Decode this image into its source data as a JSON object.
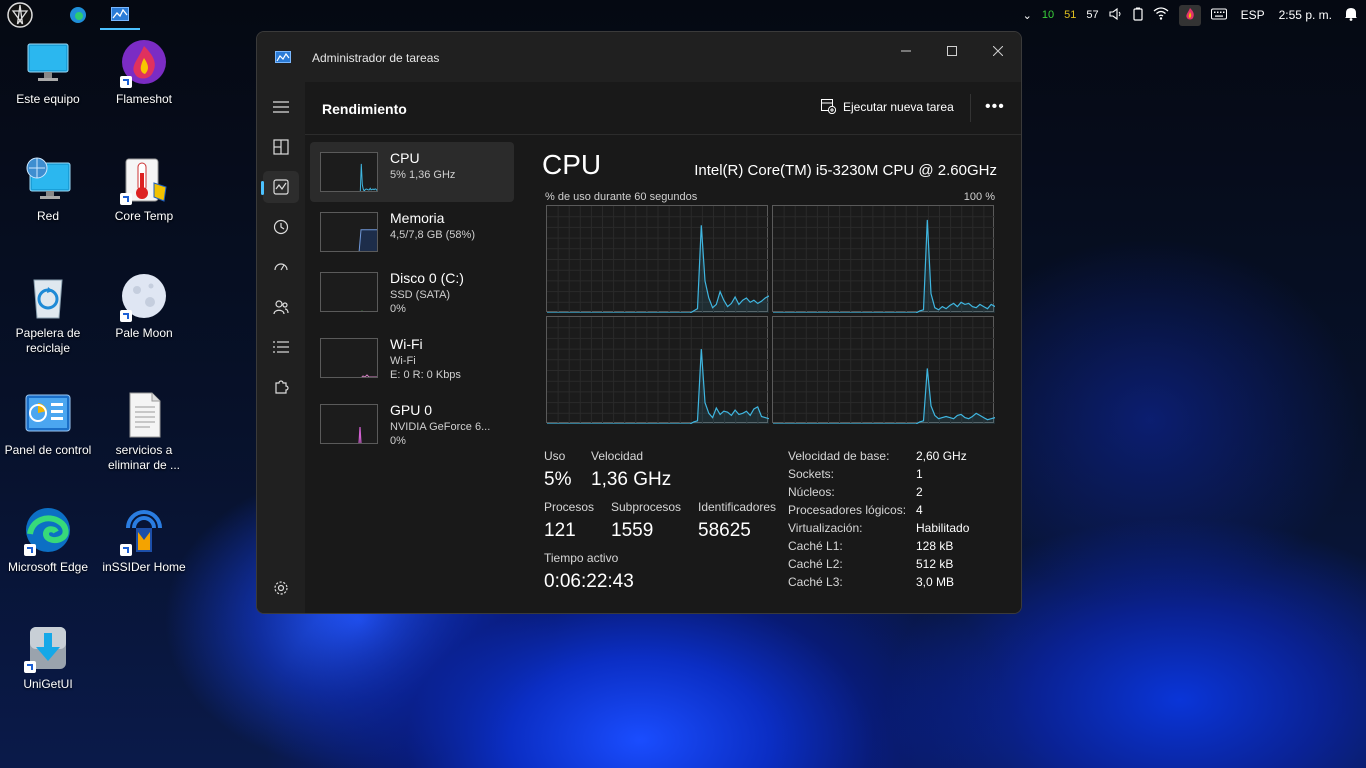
{
  "window": {
    "title": "Administrador de tareas",
    "header_title": "Rendimiento",
    "run_task_label": "Ejecutar nueva tarea",
    "more_label": "•••"
  },
  "desktop_icons": [
    {
      "label": "Este equipo",
      "icon": "computer-icon"
    },
    {
      "label": "Flameshot",
      "icon": "flameshot-icon"
    },
    {
      "label": "Red",
      "icon": "network-icon"
    },
    {
      "label": "Core Temp",
      "icon": "thermometer-icon"
    },
    {
      "label": "Papelera de reciclaje",
      "icon": "recycle-bin-icon"
    },
    {
      "label": "Pale Moon",
      "icon": "pale-moon-icon"
    },
    {
      "label": "Panel de control",
      "icon": "control-panel-icon"
    },
    {
      "label": "servicios a eliminar de ...",
      "icon": "document-icon"
    },
    {
      "label": "Microsoft Edge",
      "icon": "edge-icon"
    },
    {
      "label": "inSSIDer Home",
      "icon": "inssider-icon"
    },
    {
      "label": "UniGetUI",
      "icon": "unigetui-icon"
    }
  ],
  "tray": {
    "n1": "10",
    "n2": "51",
    "n3": "57",
    "n1_color": "#3ad13a",
    "n2_color": "#e0c020",
    "n3_color": "#ffffff",
    "language": "ESP",
    "time": "2:55 p. m."
  },
  "perf_items": [
    {
      "name": "CPU",
      "line1": "5%  1,36 GHz",
      "line2": ""
    },
    {
      "name": "Memoria",
      "line1": "4,5/7,8 GB (58%)",
      "line2": ""
    },
    {
      "name": "Disco 0 (C:)",
      "line1": "SSD (SATA)",
      "line2": "0%"
    },
    {
      "name": "Wi-Fi",
      "line1": "Wi-Fi",
      "line2": "E: 0 R: 0 Kbps"
    },
    {
      "name": "GPU 0",
      "line1": "NVIDIA GeForce 6...",
      "line2": "0%"
    }
  ],
  "cpu": {
    "title": "CPU",
    "model": "Intel(R) Core(TM) i5-3230M CPU @ 2.60GHz",
    "graph_caption": "% de uso durante 60 segundos",
    "graph_max": "100 %",
    "stats": {
      "uso_label": "Uso",
      "uso_value": "5%",
      "velocidad_label": "Velocidad",
      "velocidad_value": "1,36 GHz",
      "procesos_label": "Procesos",
      "procesos_value": "121",
      "subprocesos_label": "Subprocesos",
      "subprocesos_value": "1559",
      "identificadores_label": "Identificadores",
      "identificadores_value": "58625",
      "tiempo_label": "Tiempo activo",
      "tiempo_value": "0:06:22:43"
    },
    "specs": [
      {
        "key": "Velocidad de base:",
        "value": "2,60 GHz"
      },
      {
        "key": "Sockets:",
        "value": "1"
      },
      {
        "key": "Núcleos:",
        "value": "2"
      },
      {
        "key": "Procesadores lógicos:",
        "value": "4"
      },
      {
        "key": "Virtualización:",
        "value": "Habilitado"
      },
      {
        "key": "Caché L1:",
        "value": "128 kB"
      },
      {
        "key": "Caché L2:",
        "value": "512 kB"
      },
      {
        "key": "Caché L3:",
        "value": "3,0 MB"
      }
    ],
    "core_usage": [
      [
        0,
        0,
        0,
        0,
        0,
        0,
        0,
        0,
        0,
        0,
        0,
        0,
        0,
        0,
        0,
        0,
        0,
        0,
        0,
        0,
        0,
        0,
        0,
        0,
        0,
        0,
        0,
        0,
        0,
        0,
        0,
        0,
        0,
        0,
        0,
        0,
        0,
        0,
        0,
        2,
        4,
        82,
        30,
        14,
        5,
        8,
        20,
        12,
        6,
        9,
        15,
        8,
        12,
        14,
        10,
        12,
        9,
        11,
        14,
        16
      ],
      [
        0,
        0,
        0,
        0,
        0,
        0,
        0,
        0,
        0,
        0,
        0,
        0,
        0,
        0,
        0,
        0,
        0,
        0,
        0,
        0,
        0,
        0,
        0,
        0,
        0,
        0,
        0,
        0,
        0,
        0,
        0,
        0,
        0,
        0,
        0,
        0,
        0,
        0,
        0,
        2,
        3,
        87,
        18,
        5,
        3,
        6,
        4,
        7,
        9,
        6,
        10,
        8,
        9,
        6,
        5,
        8,
        6,
        4,
        8,
        6
      ],
      [
        0,
        0,
        0,
        0,
        0,
        0,
        0,
        0,
        0,
        0,
        0,
        0,
        0,
        0,
        0,
        0,
        0,
        0,
        0,
        0,
        0,
        0,
        0,
        0,
        0,
        0,
        0,
        0,
        0,
        0,
        0,
        0,
        0,
        0,
        0,
        0,
        0,
        0,
        0,
        2,
        3,
        70,
        20,
        10,
        6,
        15,
        9,
        12,
        11,
        8,
        13,
        9,
        10,
        12,
        8,
        14,
        16,
        7,
        6,
        5
      ],
      [
        0,
        0,
        0,
        0,
        0,
        0,
        0,
        0,
        0,
        0,
        0,
        0,
        0,
        0,
        0,
        0,
        0,
        0,
        0,
        0,
        0,
        0,
        0,
        0,
        0,
        0,
        0,
        0,
        0,
        0,
        0,
        0,
        0,
        0,
        0,
        0,
        0,
        0,
        0,
        2,
        3,
        52,
        17,
        8,
        5,
        6,
        7,
        6,
        5,
        8,
        9,
        6,
        5,
        7,
        10,
        8,
        6,
        4,
        5,
        6
      ]
    ],
    "line_color": "#3fb6e0"
  },
  "memory_usage_percent": 58
}
